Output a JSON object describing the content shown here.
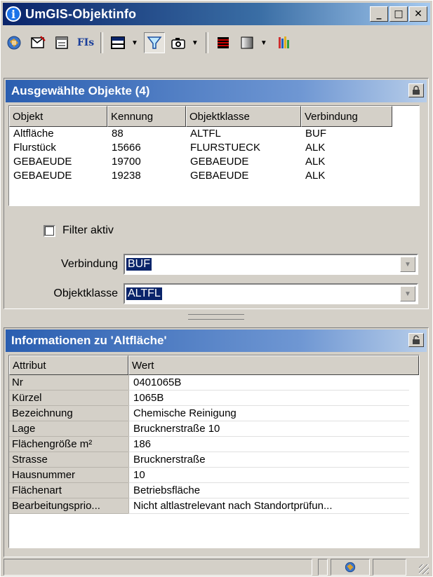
{
  "window": {
    "title": "UmGIS-Objektinfo",
    "minimize": "_",
    "maximize": "□",
    "close": "✕"
  },
  "toolbar": {
    "icons": [
      "globe-icon",
      "mail-icon",
      "form-icon",
      "fls-icon",
      "table-icon",
      "filter-icon",
      "camera-icon",
      "lines-icon",
      "gradient-icon",
      "palette-icon"
    ],
    "fls_label": "FIs"
  },
  "selected_objects": {
    "title": "Ausgewählte Objekte (4)",
    "columns": [
      "Objekt",
      "Kennung",
      "Objektklasse",
      "Verbindung"
    ],
    "rows": [
      [
        "Altfläche",
        "88",
        "ALTFL",
        "BUF"
      ],
      [
        "Flurstück",
        "15666",
        "FLURSTUECK",
        "ALK"
      ],
      [
        "GEBAEUDE",
        "19700",
        "GEBAEUDE",
        "ALK"
      ],
      [
        "GEBAEUDE",
        "19238",
        "GEBAEUDE",
        "ALK"
      ]
    ],
    "filter_label": "Filter aktiv",
    "verbindung_label": "Verbindung",
    "verbindung_value": "BUF",
    "objektklasse_label": "Objektklasse",
    "objektklasse_value": "ALTFL"
  },
  "info": {
    "title": "Informationen zu 'Altfläche'",
    "columns": [
      "Attribut",
      "Wert"
    ],
    "rows": [
      [
        "Nr",
        "0401065B"
      ],
      [
        "Kürzel",
        "1065B"
      ],
      [
        "Bezeichnung",
        "Chemische Reinigung"
      ],
      [
        "Lage",
        "Brucknerstraße 10"
      ],
      [
        "Flächengröße m²",
        "186"
      ],
      [
        "Strasse",
        "Brucknerstraße"
      ],
      [
        "Hausnummer",
        "10"
      ],
      [
        "Flächenart",
        "Betriebsfläche"
      ],
      [
        "Bearbeitungsprio...",
        "Nicht altlastrelevant nach Standortprüfun..."
      ]
    ]
  },
  "colors": {
    "titlebar": "#0a246a",
    "panel_header": "#2a5eb0",
    "face": "#d4d0c8"
  }
}
